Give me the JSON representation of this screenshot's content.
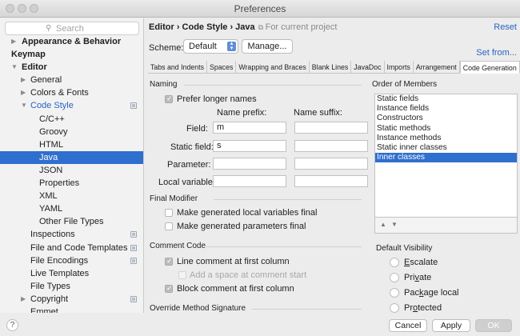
{
  "window": {
    "title": "Preferences"
  },
  "search": {
    "placeholder": "Search"
  },
  "tree": {
    "appearance": "Appearance & Behavior",
    "keymap": "Keymap",
    "editor": "Editor",
    "general": "General",
    "colors_fonts": "Colors & Fonts",
    "code_style": "Code Style",
    "cpp": "C/C++",
    "groovy": "Groovy",
    "html": "HTML",
    "java": "Java",
    "json": "JSON",
    "properties": "Properties",
    "xml": "XML",
    "yaml": "YAML",
    "other_file_types": "Other File Types",
    "inspections": "Inspections",
    "file_code_templates": "File and Code Templates",
    "file_encodings": "File Encodings",
    "live_templates": "Live Templates",
    "file_types": "File Types",
    "copyright": "Copyright",
    "emmet": "Emmet"
  },
  "header": {
    "breadcrumb": "Editor › Code Style › Java",
    "note": "For current project",
    "reset": "Reset",
    "set_from": "Set from..."
  },
  "scheme": {
    "label": "Scheme:",
    "value": "Default",
    "manage": "Manage..."
  },
  "tabs": [
    "Tabs and Indents",
    "Spaces",
    "Wrapping and Braces",
    "Blank Lines",
    "JavaDoc",
    "Imports",
    "Arrangement",
    "Code Generation"
  ],
  "naming": {
    "title": "Naming",
    "prefer_longer": "Prefer longer names",
    "prefix_header": "Name prefix:",
    "suffix_header": "Name suffix:",
    "field_label": "Field:",
    "static_field_label": "Static field:",
    "parameter_label": "Parameter:",
    "local_variable_label": "Local variable:",
    "field_prefix": "m",
    "static_field_prefix": "s"
  },
  "final_modifier": {
    "title": "Final Modifier",
    "local_vars": "Make generated local variables final",
    "params": "Make generated parameters final"
  },
  "comment_code": {
    "title": "Comment Code",
    "line_first_col": "Line comment at first column",
    "add_space": "Add a space at comment start",
    "block_first_col": "Block comment at first column"
  },
  "override": {
    "title": "Override Method Signature"
  },
  "order": {
    "title": "Order of Members",
    "items": [
      "Static fields",
      "Instance fields",
      "Constructors",
      "Static methods",
      "Instance methods",
      "Static inner classes",
      "Inner classes"
    ],
    "up_icon": "triangle-up",
    "down_icon": "triangle-down"
  },
  "visibility": {
    "title": "Default Visibility",
    "options": [
      "Escalate",
      "Private",
      "Package local",
      "Protected"
    ]
  },
  "footer": {
    "help": "?",
    "cancel": "Cancel",
    "apply": "Apply",
    "ok": "OK"
  },
  "colors": {
    "selection": "#2f6fce",
    "link": "#2a63c2"
  }
}
